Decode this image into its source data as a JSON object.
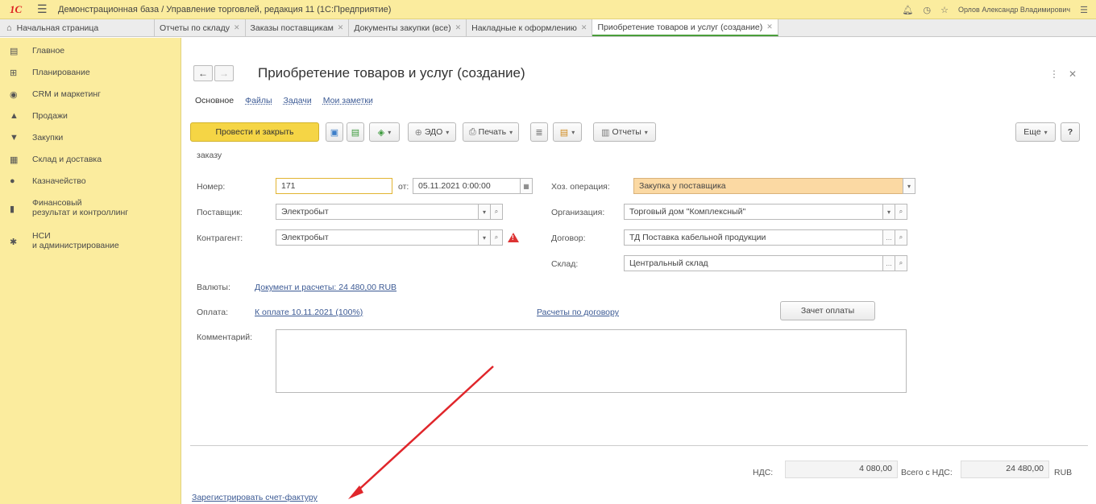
{
  "titlebar": {
    "logo": "1С",
    "app_title": "Демонстрационная база / Управление торговлей, редакция 11  (1С:Предприятие)",
    "user": "Орлов Александр Владимирович"
  },
  "tabs": [
    {
      "label": "Начальная страница"
    },
    {
      "label": "Отчеты по складу"
    },
    {
      "label": "Заказы поставщикам"
    },
    {
      "label": "Документы закупки (все)"
    },
    {
      "label": "Накладные к оформлению"
    },
    {
      "label": "Приобретение товаров и услуг (создание)"
    }
  ],
  "sidebar": {
    "items": [
      {
        "label": "Главное",
        "icon": "list-icon"
      },
      {
        "label": "Планирование",
        "icon": "planning-icon"
      },
      {
        "label": "CRM и маркетинг",
        "icon": "crm-icon"
      },
      {
        "label": "Продажи",
        "icon": "sales-icon"
      },
      {
        "label": "Закупки",
        "icon": "cart-icon"
      },
      {
        "label": "Склад и доставка",
        "icon": "warehouse-icon"
      },
      {
        "label": "Казначейство",
        "icon": "treasury-icon"
      },
      {
        "label": "Финансовый",
        "label2": "результат и контроллинг",
        "icon": "chart-icon"
      },
      {
        "label": "НСИ",
        "label2": "и администрирование",
        "icon": "gear-icon"
      }
    ]
  },
  "form": {
    "title": "Приобретение товаров и услуг (создание)",
    "tabs": [
      "Основное",
      "Файлы",
      "Задачи",
      "Мои заметки"
    ],
    "toolbar": {
      "post_close": "Провести и закрыть",
      "edo": "ЭДО",
      "print": "Печать",
      "reports": "Отчеты",
      "more": "Еще",
      "help": "?"
    },
    "partial_label": "заказу",
    "number_label": "Номер:",
    "number_value": "171",
    "date_label": "от:",
    "date_value": "05.11.2021  0:00:00",
    "operation_label": "Хоз. операция:",
    "operation_value": "Закупка у поставщика",
    "supplier_label": "Поставщик:",
    "supplier_value": "Электробыт",
    "org_label": "Организация:",
    "org_value": "Торговый дом \"Комплексный\"",
    "counterparty_label": "Контрагент:",
    "counterparty_value": "Электробыт",
    "contract_label": "Договор:",
    "contract_value": "ТД Поставка кабельной продукции",
    "warehouse_label": "Склад:",
    "warehouse_value": "Центральный склад",
    "currency_label": "Валюты:",
    "currency_link": "Документ и расчеты: 24 480,00 RUB",
    "payment_label": "Оплата:",
    "payment_link": "К оплате 10.11.2021 (100%)",
    "settlements_link": "Расчеты по договору",
    "offset_button": "Зачет оплаты",
    "comment_label": "Комментарий:",
    "comment_value": "",
    "vat_label": "НДС:",
    "vat_value": "4 080,00",
    "total_label": "Всего с НДС:",
    "total_value": "24 480,00",
    "currency": "RUB",
    "register_invoice_link": "Зарегистрировать счет-фактуру"
  },
  "colors": {
    "sidebar_bg": "#fbec9e",
    "primary_button": "#f5d545",
    "link": "#3c5a94",
    "highlight_field": "#fbd9a3",
    "arrow": "#e0262b"
  }
}
